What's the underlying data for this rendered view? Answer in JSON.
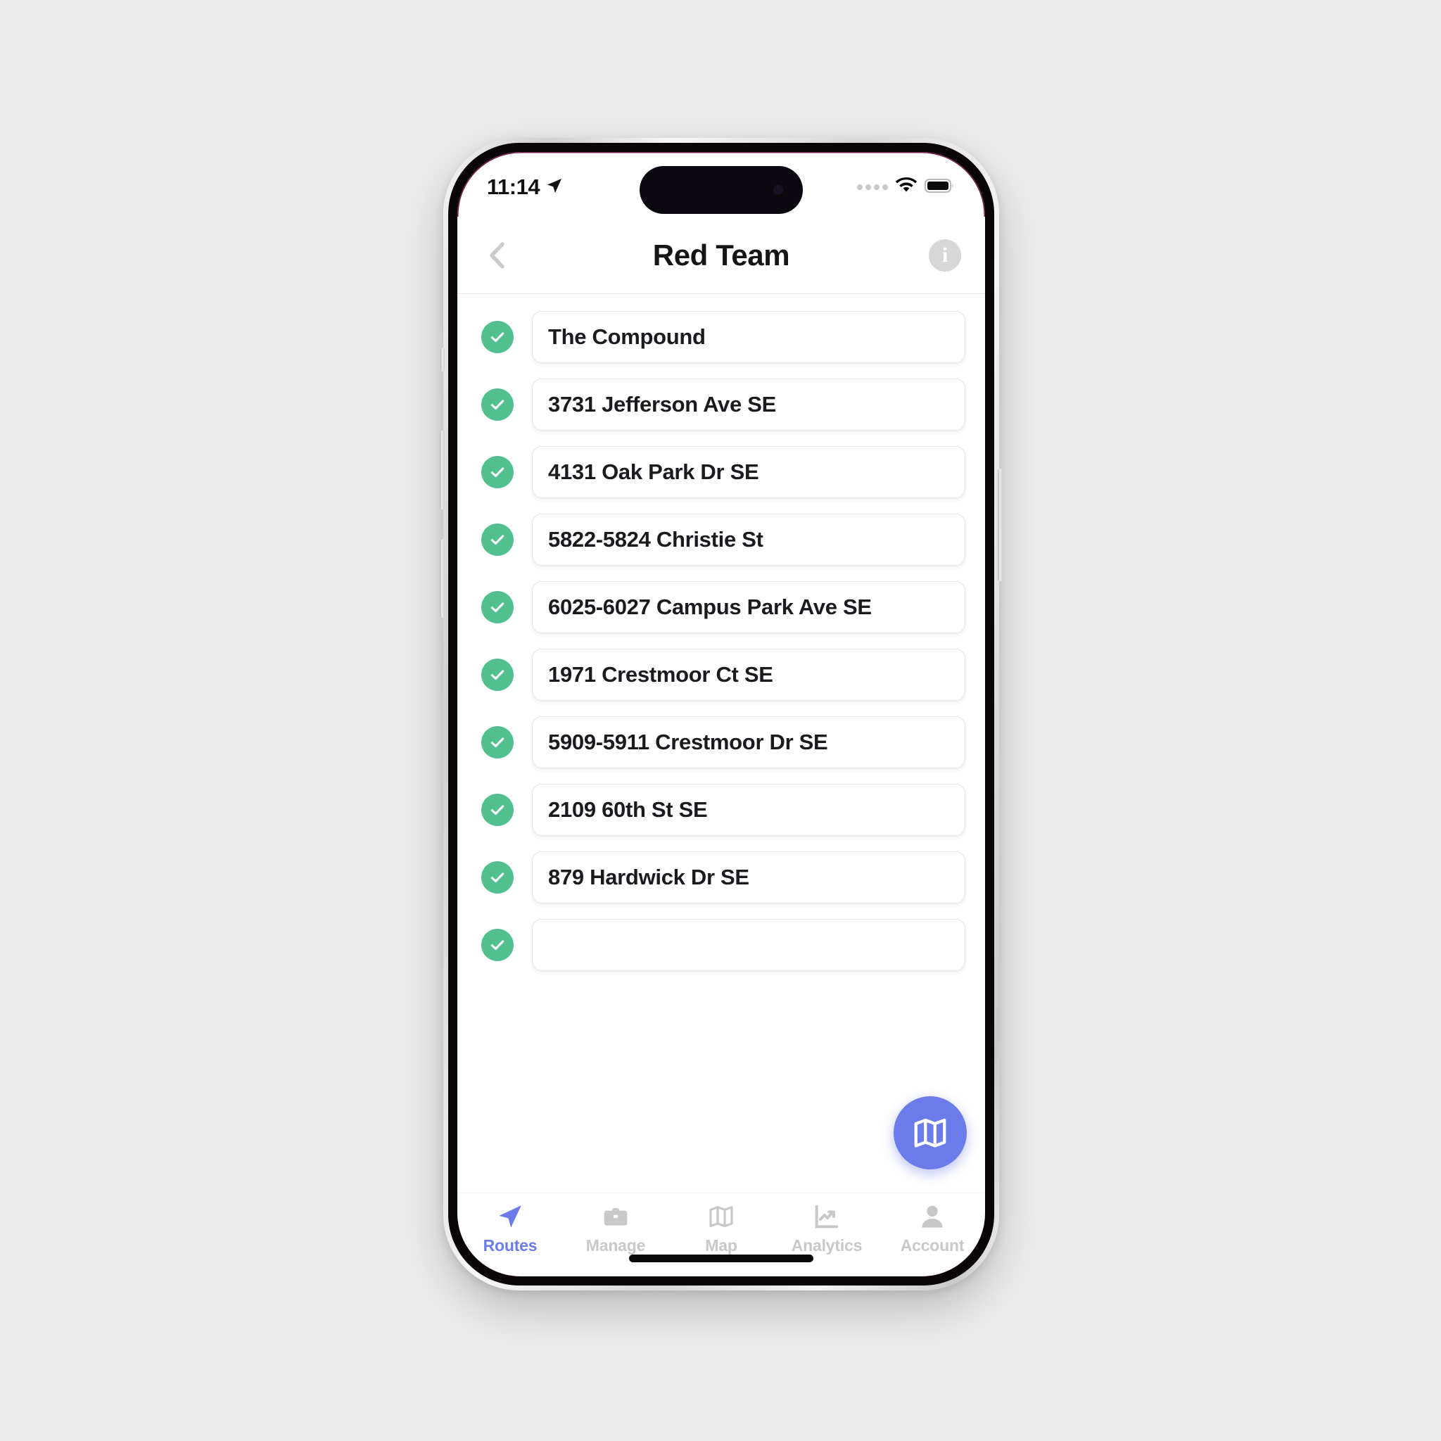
{
  "status_bar": {
    "time": "11:14",
    "location_icon": "location-arrow-icon",
    "signal_icon": "cellular-dots-icon",
    "wifi_icon": "wifi-icon",
    "battery_icon": "battery-full-icon"
  },
  "header": {
    "title": "Red Team",
    "back_icon": "chevron-left-icon",
    "info_icon": "info-circle-icon",
    "info_label": "i"
  },
  "colors": {
    "accent_blue": "#6b7cea",
    "check_green": "#52c08c",
    "inactive_grey": "#c8c8c8",
    "card_border": "#e4e4e4",
    "page_background": "#ebebeb"
  },
  "stops": [
    {
      "label": "The Compound",
      "completed": true
    },
    {
      "label": "3731 Jefferson Ave SE",
      "completed": true
    },
    {
      "label": "4131 Oak Park Dr SE",
      "completed": true
    },
    {
      "label": "5822-5824 Christie St",
      "completed": true
    },
    {
      "label": "6025-6027 Campus Park Ave SE",
      "completed": true
    },
    {
      "label": "1971 Crestmoor Ct SE",
      "completed": true
    },
    {
      "label": "5909-5911 Crestmoor Dr SE",
      "completed": true
    },
    {
      "label": "2109 60th St SE",
      "completed": true
    },
    {
      "label": "879 Hardwick Dr SE",
      "completed": true
    },
    {
      "label": "",
      "completed": true
    }
  ],
  "fab": {
    "icon": "map-fold-icon",
    "action": "open-map"
  },
  "tabs": [
    {
      "label": "Routes",
      "icon": "navigation-arrow-icon",
      "active": true
    },
    {
      "label": "Manage",
      "icon": "briefcase-icon",
      "active": false
    },
    {
      "label": "Map",
      "icon": "map-fold-icon",
      "active": false
    },
    {
      "label": "Analytics",
      "icon": "chart-trend-icon",
      "active": false
    },
    {
      "label": "Account",
      "icon": "person-icon",
      "active": false
    }
  ]
}
